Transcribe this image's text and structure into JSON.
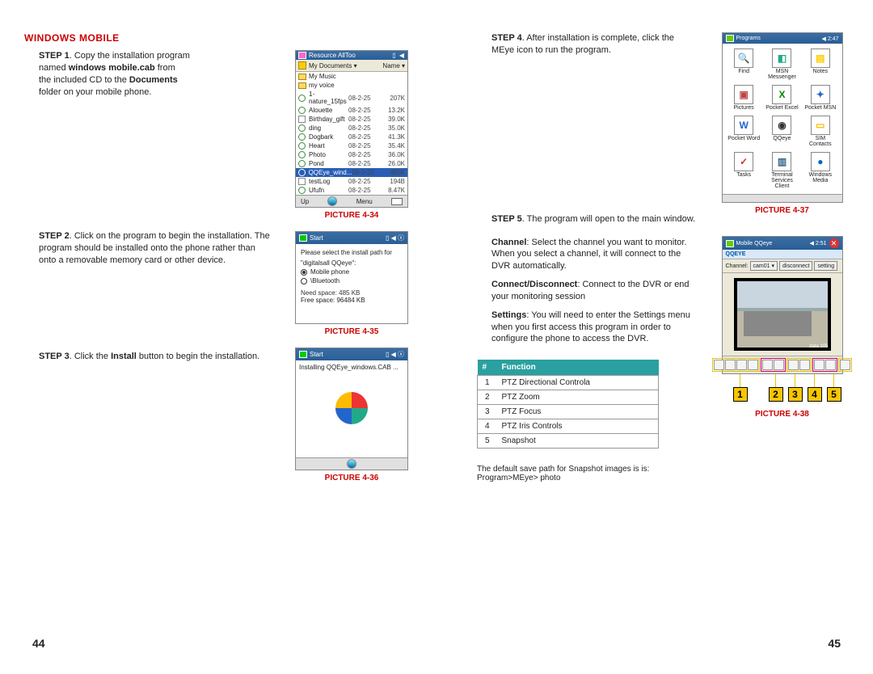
{
  "page_numbers": {
    "left": "44",
    "right": "45"
  },
  "left_page": {
    "title": "WINDOWS MOBILE",
    "step1": {
      "label": "STEP 1",
      "t1": ". Copy the installation program",
      "t2": "named ",
      "bold2": "windows mobile.cab",
      "t3": " from",
      "t4": "the included CD to the ",
      "bold4": "Documents",
      "t5": "folder on your mobile phone."
    },
    "step2": {
      "label": "STEP 2",
      "text": ". Click on the program to begin the installation. The program should be installed onto the phone rather than onto a removable memory card or other device."
    },
    "step3": {
      "label": "STEP 3",
      "t1": ". Click the ",
      "bold": "Install",
      "t2": " button to begin the installation."
    },
    "pic34": {
      "caption": "PICTURE 4-34",
      "title": "Resource AllToo",
      "time_icons": "▯ ◀",
      "folder_label": "My Documents ▾",
      "name_col": "Name ▾",
      "rows": [
        {
          "name": "My Music",
          "type": "folder"
        },
        {
          "name": "my voice",
          "type": "folder"
        },
        {
          "name": "1-nature_15fps",
          "date": "08-2-25",
          "size": "207K"
        },
        {
          "name": "Alouette",
          "date": "08-2-25",
          "size": "13.2K"
        },
        {
          "name": "Birthday_gift",
          "date": "08-2-25",
          "size": "39.0K"
        },
        {
          "name": "ding",
          "date": "08-2-25",
          "size": "35.0K"
        },
        {
          "name": "Dogbark",
          "date": "08-2-25",
          "size": "41.3K"
        },
        {
          "name": "Heart",
          "date": "08-2-25",
          "size": "35.4K"
        },
        {
          "name": "Photo",
          "date": "08-2-25",
          "size": "36.0K"
        },
        {
          "name": "Pond",
          "date": "08-2-25",
          "size": "26.0K"
        },
        {
          "name": "QQEye_wind...",
          "date": "09-2-20",
          "size": "485K",
          "selected": true
        },
        {
          "name": "testLog",
          "date": "08-2-25",
          "size": "194B"
        },
        {
          "name": "Ufufn",
          "date": "08-2-25",
          "size": "8.47K"
        }
      ],
      "bottom_up": "Up",
      "bottom_menu": "Menu"
    },
    "pic35": {
      "caption": "PICTURE 4-35",
      "title": "Start",
      "prompt": "Please select the install path for",
      "prompt2": "\"digitalsall QQeye\":",
      "opt1": "Mobile phone",
      "opt2": "\\Bluetooth",
      "need": "Need space: 485 KB",
      "free": "Free space: 96484 KB"
    },
    "pic36": {
      "caption": "PICTURE 4-36",
      "title": "Start",
      "text": "Installing QQEye_windows.CAB ..."
    }
  },
  "right_page": {
    "step4": {
      "label": "STEP 4",
      "text": ". After installation is complete, click the MEye icon to run the program."
    },
    "step5": {
      "label": "STEP 5",
      "text": ". The program will open to the main window."
    },
    "desc_channel": {
      "bold": "Channel",
      "text": ": Select the channel you want to monitor. When you select a channel, it will connect to the DVR automatically."
    },
    "desc_connect": {
      "bold": "Connect/Disconnect",
      "text": ": Connect to the DVR or end your monitoring session"
    },
    "desc_settings": {
      "bold": "Settings",
      "text": ": You will need to enter the Settings menu when you first access this program in order to configure the phone to access the DVR."
    },
    "func_table": {
      "header_num": "#",
      "header_func": "Function",
      "rows": [
        {
          "n": "1",
          "f": "PTZ Directional Controla"
        },
        {
          "n": "2",
          "f": "PTZ Zoom"
        },
        {
          "n": "3",
          "f": "PTZ Focus"
        },
        {
          "n": "4",
          "f": "PTZ Iris Controls"
        },
        {
          "n": "5",
          "f": "Snapshot"
        }
      ]
    },
    "note": "The default save path for Snapshot images is is: Program>MEye> photo",
    "pic37": {
      "caption": "PICTURE 4-37",
      "title": "Programs",
      "time": "◀ 2:47",
      "apps": [
        {
          "lbl": "Find",
          "glyph": "🔍",
          "color": "#36a"
        },
        {
          "lbl": "MSN Messenger",
          "glyph": "◧",
          "color": "#2a8"
        },
        {
          "lbl": "Notes",
          "glyph": "▤",
          "color": "#fc0"
        },
        {
          "lbl": "Pictures",
          "glyph": "▣",
          "color": "#b44"
        },
        {
          "lbl": "Pocket Excel",
          "glyph": "X",
          "color": "#080"
        },
        {
          "lbl": "Pocket MSN",
          "glyph": "✦",
          "color": "#26c"
        },
        {
          "lbl": "Pocket Word",
          "glyph": "W",
          "color": "#26c"
        },
        {
          "lbl": "QQeye",
          "glyph": "◉",
          "color": "#333"
        },
        {
          "lbl": "SIM Contacts",
          "glyph": "▭",
          "color": "#fb0"
        },
        {
          "lbl": "Tasks",
          "glyph": "✓",
          "color": "#c33"
        },
        {
          "lbl": "Terminal Services Client",
          "glyph": "▥",
          "color": "#368"
        },
        {
          "lbl": "Windows Media",
          "glyph": "●",
          "color": "#06c"
        }
      ]
    },
    "pic38": {
      "caption": "PICTURE 4-38",
      "title": "Mobile QQeye",
      "time": "◀ 2:51",
      "sub": "QQEYE",
      "channel_label": "Channel:",
      "channel_value": "cam01 ▾",
      "btn_disconnect": "disconnect",
      "btn_setting": "setting",
      "video_label": "data 105",
      "callouts": [
        "1",
        "2",
        "3",
        "4",
        "5"
      ]
    }
  }
}
